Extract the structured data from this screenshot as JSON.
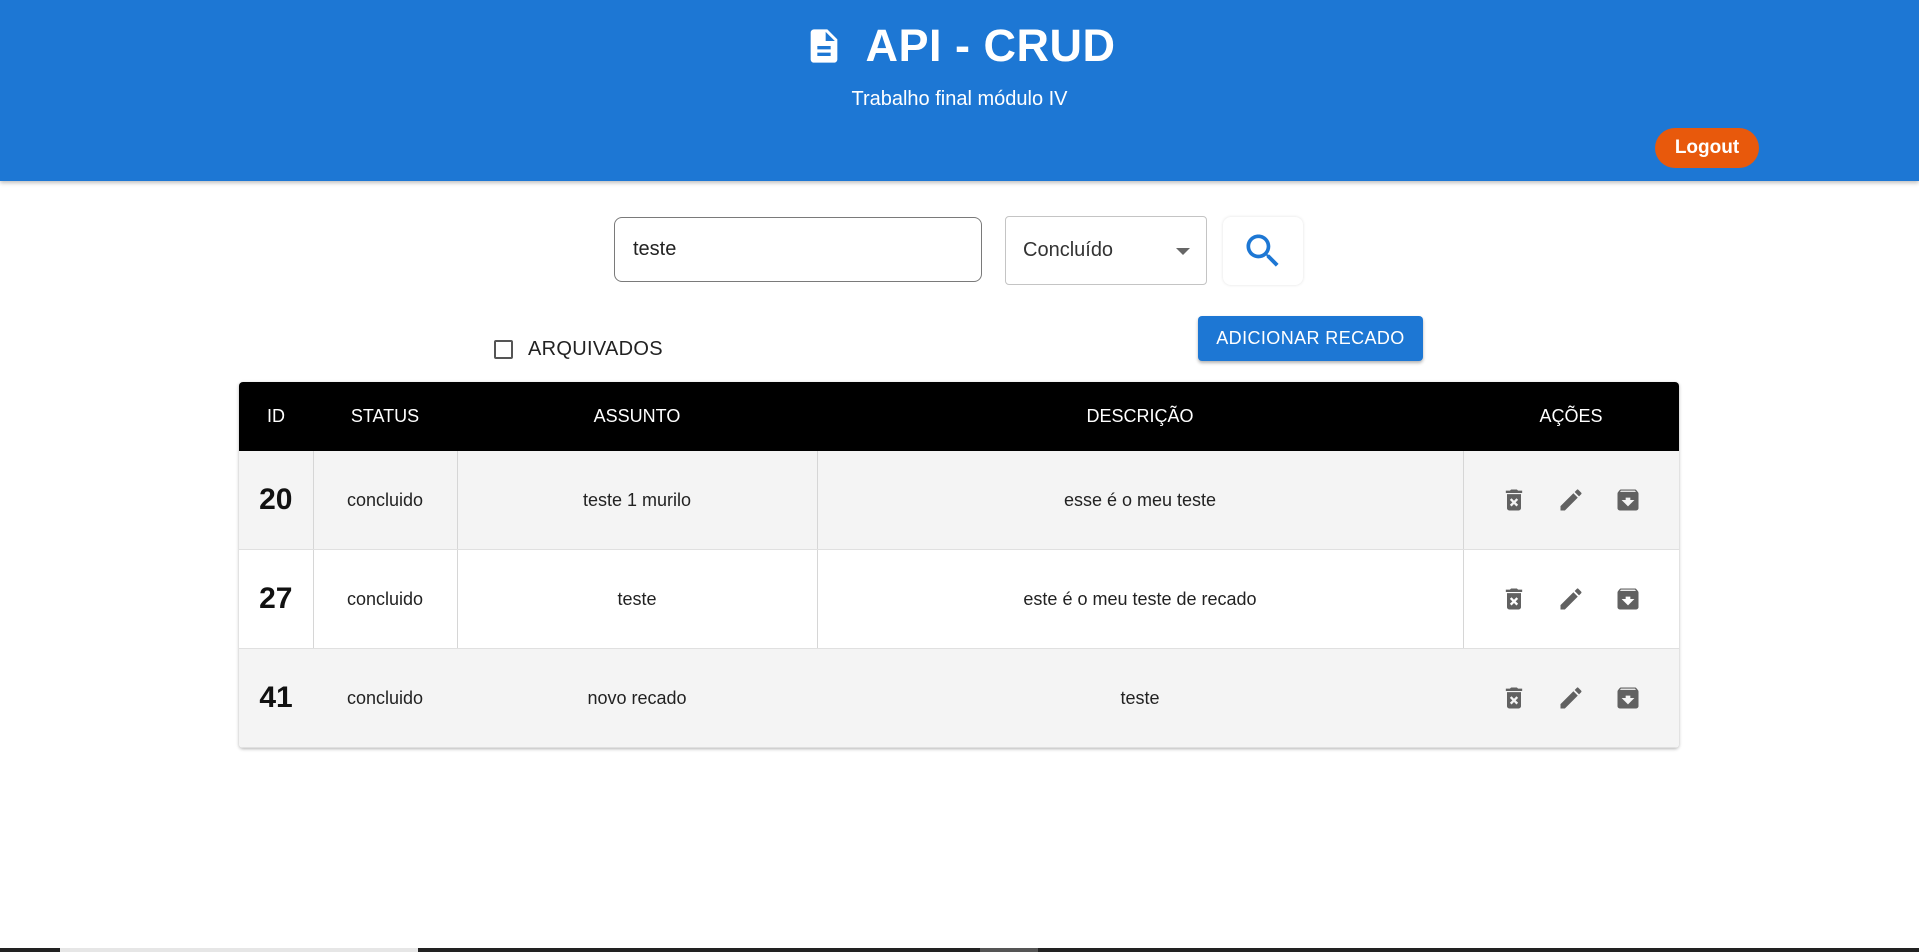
{
  "header": {
    "title": "API - CRUD",
    "subtitle": "Trabalho final módulo IV",
    "logout_label": "Logout",
    "background_color": "#1d77d4",
    "logout_color": "#e8590c"
  },
  "filters": {
    "search_value": "teste",
    "status_selected": "Concluído",
    "search_icon": "search-icon",
    "archived_label": "ARQUIVADOS",
    "archived_checked": false,
    "add_button_label": "ADICIONAR RECADO"
  },
  "table": {
    "columns": [
      "ID",
      "STATUS",
      "ASSUNTO",
      "DESCRIÇÃO",
      "AÇÕES"
    ],
    "rows": [
      {
        "id": "20",
        "status": "concluido",
        "subject": "teste 1 murilo",
        "description": "esse é o meu teste"
      },
      {
        "id": "27",
        "status": "concluido",
        "subject": "teste",
        "description": "este é o meu teste de recado"
      },
      {
        "id": "41",
        "status": "concluido",
        "subject": "novo recado",
        "description": "teste"
      }
    ],
    "row_actions": [
      "delete-icon",
      "edit-icon",
      "archive-icon"
    ]
  }
}
